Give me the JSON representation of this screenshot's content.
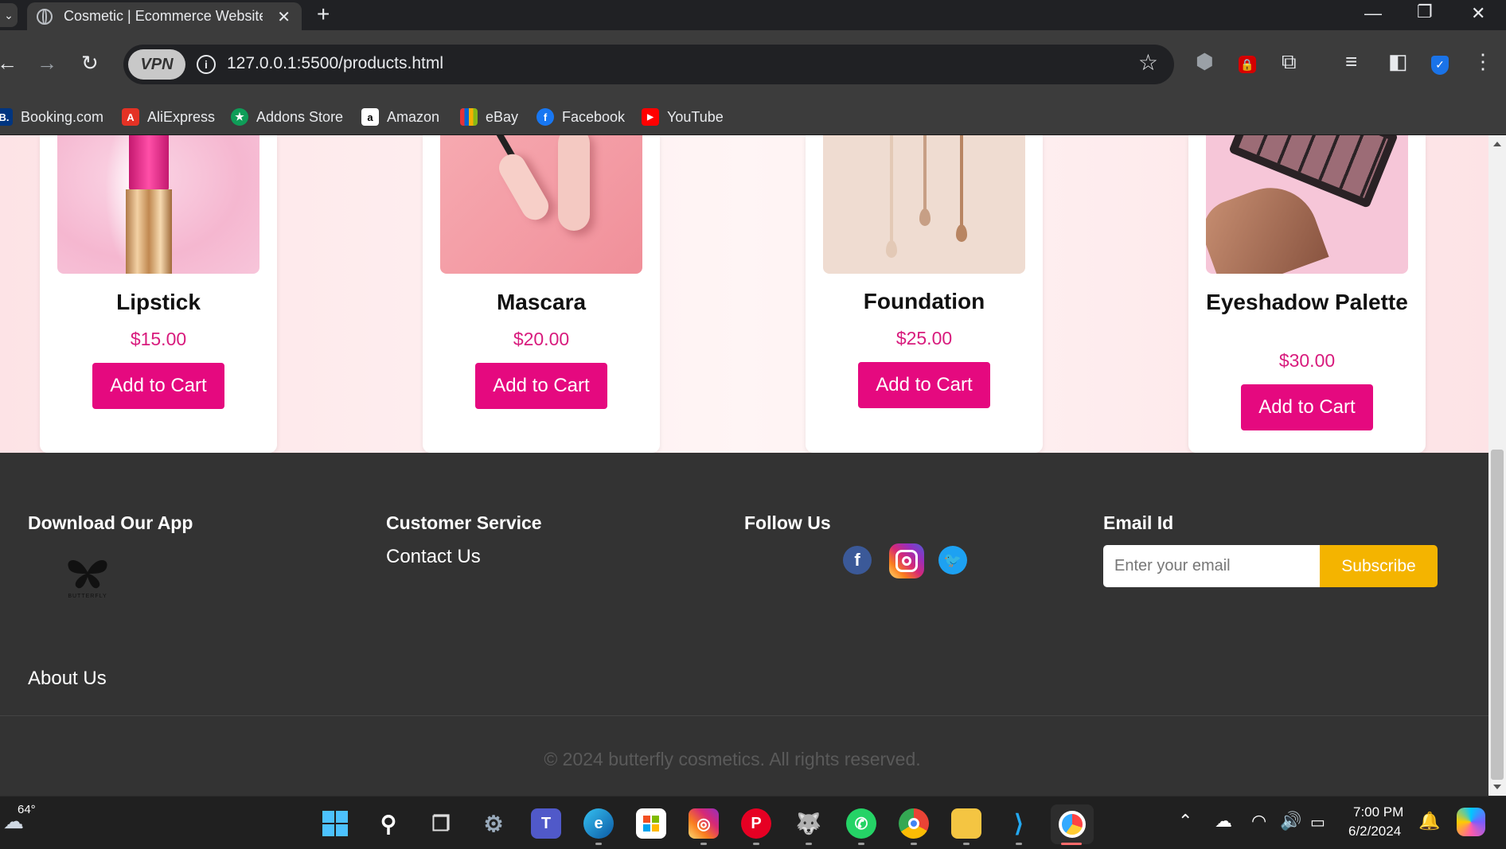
{
  "browser": {
    "tab_title": "Cosmetic | Ecommerce Website",
    "new_tab": "+",
    "url": "127.0.0.1:5500/products.html",
    "vpn_label": "VPN",
    "bookmarks": [
      {
        "label": "Booking.com",
        "icon": "booking-icon",
        "color": "#003580",
        "glyph": "B."
      },
      {
        "label": "AliExpress",
        "icon": "aliexpress-icon",
        "color": "#e43225",
        "glyph": "A"
      },
      {
        "label": "Addons Store",
        "icon": "addons-store-icon",
        "color": "#0f9d58",
        "glyph": "★"
      },
      {
        "label": "Amazon",
        "icon": "amazon-icon",
        "color": "#ffffff",
        "glyph": "a"
      },
      {
        "label": "eBay",
        "icon": "ebay-icon",
        "color": "#e53238",
        "glyph": "e"
      },
      {
        "label": "Facebook",
        "icon": "facebook-icon",
        "color": "#1877f2",
        "glyph": "f"
      },
      {
        "label": "YouTube",
        "icon": "youtube-icon",
        "color": "#ff0000",
        "glyph": "▶"
      }
    ]
  },
  "products": [
    {
      "name": "Lipstick",
      "price": "$15.00",
      "button": "Add to Cart"
    },
    {
      "name": "Mascara",
      "price": "$20.00",
      "button": "Add to Cart"
    },
    {
      "name": "Foundation",
      "price": "$25.00",
      "button": "Add to Cart"
    },
    {
      "name": "Eyeshadow Palette",
      "price": "$30.00",
      "button": "Add to Cart"
    }
  ],
  "footer": {
    "download_heading": "Download Our App",
    "logo_text": "BUTTERFLY",
    "about": "About Us",
    "service_heading": "Customer Service",
    "contact": "Contact Us",
    "follow_heading": "Follow Us",
    "email_heading": "Email Id",
    "email_placeholder": "Enter your email",
    "subscribe": "Subscribe",
    "copyright": "© 2024 butterfly cosmetics. All rights reserved."
  },
  "taskbar": {
    "weather_temp": "64°",
    "time": "7:00 PM",
    "date": "6/2/2024"
  },
  "colors": {
    "accent": "#e5097f",
    "price": "#d81b7d",
    "subscribe": "#f4b400",
    "footer_bg": "#333333"
  }
}
